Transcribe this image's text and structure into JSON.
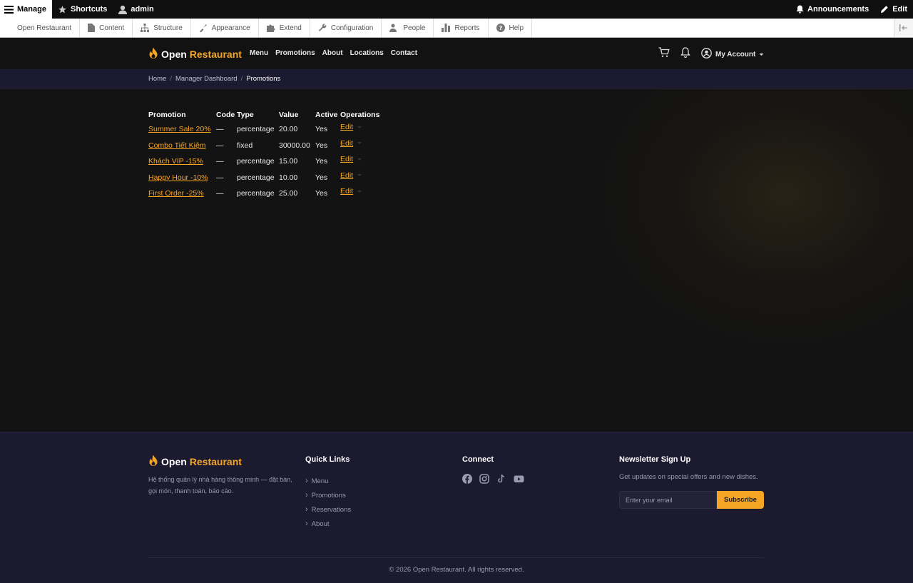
{
  "toolbar": {
    "manage": "Manage",
    "shortcuts": "Shortcuts",
    "user": "admin",
    "announcements": "Announcements",
    "edit": "Edit"
  },
  "tray": {
    "items": [
      "Open Restaurant",
      "Content",
      "Structure",
      "Appearance",
      "Extend",
      "Configuration",
      "People",
      "Reports",
      "Help"
    ]
  },
  "site": {
    "brand_part1": "Open",
    "brand_part2": "Restaurant",
    "nav": [
      "Menu",
      "Promotions",
      "About",
      "Locations",
      "Contact"
    ],
    "account_label": "My Account"
  },
  "breadcrumb": {
    "items": [
      "Home",
      "Manager Dashboard"
    ],
    "current": "Promotions"
  },
  "table": {
    "headers": [
      "Promotion",
      "Code",
      "Type",
      "Value",
      "Active",
      "Operations"
    ],
    "rows": [
      {
        "promotion": "Summer Sale 20%",
        "code": "—",
        "type": "percentage",
        "value": "20.00",
        "active": "Yes",
        "op": "Edit"
      },
      {
        "promotion": "Combo Tiết Kiệm",
        "code": "—",
        "type": "fixed",
        "value": "30000.00",
        "active": "Yes",
        "op": "Edit"
      },
      {
        "promotion": "Khách VIP -15%",
        "code": "—",
        "type": "percentage",
        "value": "15.00",
        "active": "Yes",
        "op": "Edit"
      },
      {
        "promotion": "Happy Hour -10%",
        "code": "—",
        "type": "percentage",
        "value": "10.00",
        "active": "Yes",
        "op": "Edit"
      },
      {
        "promotion": "First Order -25%",
        "code": "—",
        "type": "percentage",
        "value": "25.00",
        "active": "Yes",
        "op": "Edit"
      }
    ]
  },
  "footer": {
    "brand_part1": "Open",
    "brand_part2": "Restaurant",
    "description": "Hệ thống quản lý nhà hàng thông minh — đặt bàn, gọi món, thanh toán, báo cáo.",
    "quick_links_title": "Quick Links",
    "quick_links": [
      "Menu",
      "Promotions",
      "Reservations",
      "About"
    ],
    "connect_title": "Connect",
    "social_icons": [
      "facebook-icon",
      "instagram-icon",
      "tiktok-icon",
      "youtube-icon"
    ],
    "newsletter_title": "Newsletter Sign Up",
    "newsletter_desc": "Get updates on special offers and new dishes.",
    "email_placeholder": "Enter your email",
    "subscribe_label": "Subscribe",
    "copyright": "© 2026 Open Restaurant. All rights reserved."
  },
  "colors": {
    "accent": "#f5a524",
    "footer_bg": "#1b1a2f",
    "main_bg": "#131313"
  }
}
